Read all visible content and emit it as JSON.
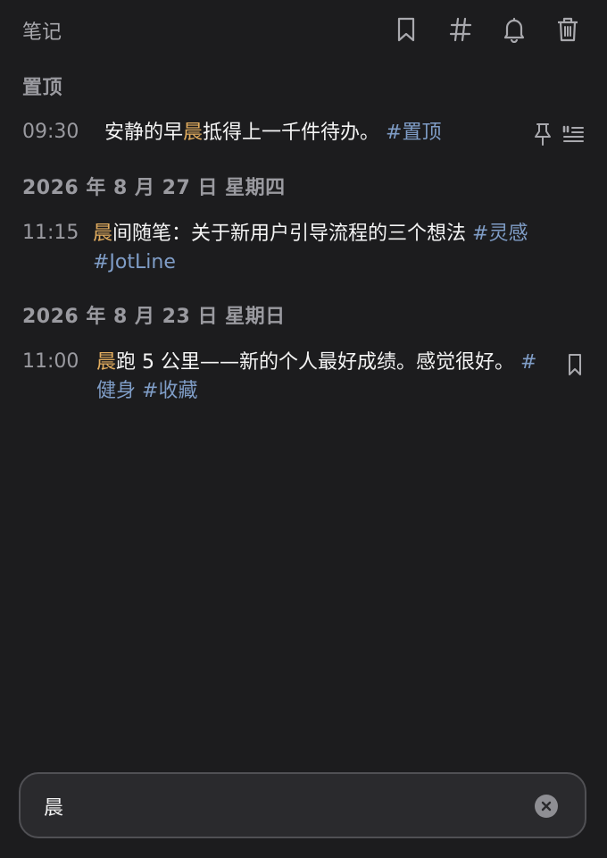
{
  "header": {
    "title": "笔记",
    "icons": [
      "bookmark-icon",
      "hashtag-icon",
      "bell-icon",
      "trash-icon"
    ]
  },
  "sections": [
    {
      "label": "置顶"
    },
    {
      "label": "2026 年 8 月 27 日 星期四"
    },
    {
      "label": "2026 年 8 月 23 日 星期日"
    }
  ],
  "notes": [
    {
      "time": "09:30",
      "before": "安静的早",
      "match": "晨",
      "after": "抵得上一千件待办。 ",
      "tags": [
        "#置顶"
      ],
      "icons": [
        "pin-icon",
        "quote-list-icon"
      ]
    },
    {
      "time": "11:15",
      "before": "",
      "match": "晨",
      "after": "间随笔：关于新用户引导流程的三个想法 ",
      "tags": [
        "#灵感",
        "#JotLine"
      ]
    },
    {
      "time": "11:00",
      "before": "",
      "match": "晨",
      "after": "跑 5 公里——新的个人最好成绩。感觉很好。 ",
      "tags": [
        "#健身",
        "#收藏"
      ],
      "icons": [
        "bookmark-icon"
      ]
    }
  ],
  "search": {
    "value": "晨",
    "placeholder": ""
  },
  "colors": {
    "background": "#1c1c1e",
    "highlight": "#e2ad5f",
    "tag": "#7f9dc7",
    "muted": "#9a9aa0"
  }
}
